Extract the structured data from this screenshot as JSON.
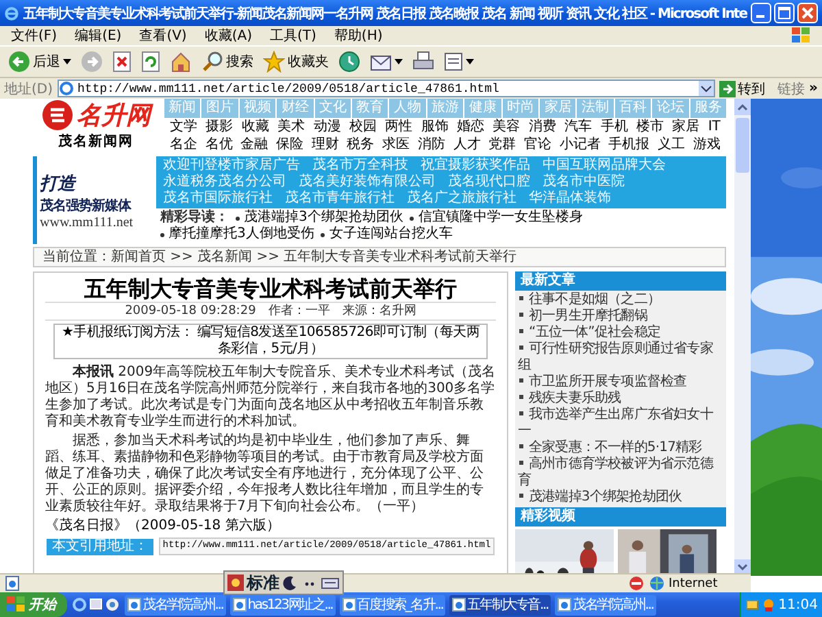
{
  "window": {
    "title": "五年制大专音美专业术科考试前天举行-新闻茂名新闻网一名升网 茂名日报 茂名晚报 茂名 新闻 视听 资讯 文化 社区 - Microsoft Inte"
  },
  "menu": [
    "文件(F)",
    "编辑(E)",
    "查看(V)",
    "收藏(A)",
    "工具(T)",
    "帮助(H)"
  ],
  "toolbar": [
    {
      "kind": "back",
      "label": "后退"
    },
    {
      "kind": "forward"
    },
    {
      "kind": "stop"
    },
    {
      "kind": "refresh"
    },
    {
      "kind": "home"
    },
    {
      "kind": "search",
      "label": "搜索"
    },
    {
      "kind": "favorites",
      "label": "收藏夹"
    },
    {
      "kind": "history"
    },
    {
      "kind": "mail"
    },
    {
      "kind": "print"
    },
    {
      "kind": "edit"
    }
  ],
  "address_bar": {
    "label": "地址(D)",
    "value": "http://www.mm111.net/article/2009/0518/article_47861.html",
    "go": "转到",
    "links": "链接",
    "more": "»"
  },
  "site": {
    "logo": {
      "name": "名升网",
      "subtitle": "茂名新闻网"
    },
    "nav_tabs": [
      "新闻",
      "图片",
      "视频",
      "财经",
      "文化",
      "教育",
      "人物",
      "旅游",
      "健康",
      "时尚",
      "家居",
      "法制",
      "百科",
      "论坛",
      "服务"
    ],
    "nav_rows": [
      [
        "文学",
        "摄影",
        "收藏",
        "美术",
        "动漫",
        "校园",
        "两性",
        "服饰",
        "婚恋",
        "美容",
        "消费",
        "汽车",
        "手机",
        "楼市",
        "家居",
        "IT"
      ],
      [
        "名企",
        "名优",
        "金融",
        "保险",
        "理财",
        "税务",
        "求医",
        "消防",
        "人才",
        "党群",
        "官论",
        "小记者",
        "手机报",
        "义工",
        "游戏"
      ]
    ],
    "slogan": {
      "line1": "打造",
      "line2": "茂名强势新媒体",
      "url": "www.mm111.net"
    },
    "ad_links": [
      "欢迎刊登楼市家居广告",
      "茂名市万全科技",
      "祝宜摄影获奖作品",
      "中国互联网品牌大会",
      "永道税务茂名分公司",
      "茂名美好装饰有限公司",
      "茂名现代口腔",
      "茂名市中医院",
      "茂名市国际旅行社",
      "茂名市青年旅行社",
      "茂名广之旅旅行社",
      "华洋晶体装饰"
    ],
    "highlights": {
      "label": "精彩导读：",
      "items": [
        "茂港端掉3个绑架抢劫团伙",
        "信宜镇隆中学一女生坠楼身",
        "摩托撞摩托3人倒地受伤",
        "女子连闯站台挖火车"
      ]
    },
    "breadcrumb": "当前位置：新闻首页 >> 茂名新闻 >> 五年制大专音美专业术科考试前天举行"
  },
  "article": {
    "title": "五年制大专音美专业术科考试前天举行",
    "meta": "2009-05-18 09:28:29　作者：一平　来源：名升网",
    "subscription": "★手机报纸订阅方法： 编写短信8发送至106585726即可订制（每天两条彩信，5元/月）",
    "paragraphs": [
      "**本报讯** 2009年高等院校五年制大专院音乐、美术专业术科考试（茂名地区）5月16日在茂名学院高州师范分院举行，来自我市各地的300多名学生参加了考试。此次考试是专门为面向茂名地区从中考招收五年制音乐教育和美术教育专业学生而进行的术科加试。",
      "据悉，参加当天术科考试的均是初中毕业生，他们参加了声乐、舞蹈、练耳、素描静物和色彩静物等项目的考试。由于市教育局及学校方面做足了准备功夫，确保了此次考试安全有序地进行，充分体现了公平、公开、公正的原则。据评委介绍，今年报考人数比往年增加，而且学生的专业素质较往年好。录取结果将于7月下旬向社会公布。（一平）"
    ],
    "source": "《茂名日报》（2009-05-18 第六版）",
    "quote_label": "本文引用地址：",
    "quote_url": "http://www.mm111.net/article/2009/0518/article_47861.html"
  },
  "sidebar": {
    "latest_title": "最新文章",
    "latest": [
      "往事不是如烟（之二）",
      "初一男生开摩托翻锅",
      "“五位一体”促社会稳定",
      "可行性研究报告原则通过省专家组",
      "市卫监所开展专项监督检查",
      "残疾夫妻乐助残",
      "我市选举产生出席广东省妇女十一",
      "全家受惠：不一样的5·17精彩",
      "高州市德育学校被评为省示范德育",
      "茂港端掉3个绑架抢劫团伙"
    ],
    "video_title": "精彩视频",
    "videos": [
      {
        "kind": "snow"
      },
      {
        "kind": "indoor"
      }
    ]
  },
  "status_bar": {
    "zone": "Internet"
  },
  "ime": {
    "mode": "标准"
  },
  "taskbar": {
    "start": "开始",
    "tasks": [
      {
        "label": "茂名学院高州...",
        "selected": false
      },
      {
        "label": "has123网址之...",
        "selected": false
      },
      {
        "label": "百度搜索_名升...",
        "selected": false
      },
      {
        "label": "五年制大专音...",
        "selected": true
      },
      {
        "label": "茂名学院高州...",
        "selected": false
      }
    ],
    "clock": "11:04"
  }
}
